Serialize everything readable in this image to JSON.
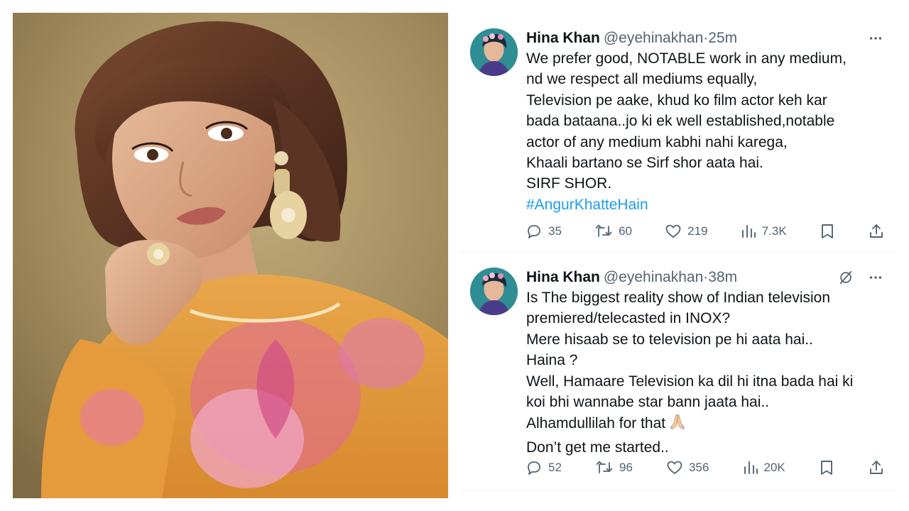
{
  "photo": {
    "subject": "portrait-photo"
  },
  "tweets": [
    {
      "name": "Hina Khan",
      "handle": "@eyehinakhan",
      "dot": "·",
      "time": "25m",
      "lines": [
        "We prefer good, NOTABLE work in any medium,",
        "nd we respect all mediums equally,",
        "Television pe aake, khud ko film actor keh kar",
        "bada bataana..jo ki ek well established,notable",
        "actor of any medium kabhi nahi karega,",
        "Khaali bartano se Sirf shor aata hai.",
        "SIRF SHOR."
      ],
      "hashtag": "#AngurKhatteHain",
      "replies": "35",
      "retweets": "60",
      "likes": "219",
      "views": "7.3K"
    },
    {
      "name": "Hina Khan",
      "handle": "@eyehinakhan",
      "dot": "·",
      "time": "38m",
      "lines": [
        "Is The biggest reality show of Indian television",
        "premiered/telecasted in INOX?",
        "Mere hisaab se to television pe hi aata hai..",
        "Haina ?",
        "Well, Hamaare Television ka dil hi itna bada hai ki",
        "koi bhi wannabe star bann jaata hai..",
        "Alhamdullilah for that",
        "Don’t get me started.."
      ],
      "replies": "52",
      "retweets": "96",
      "likes": "356",
      "views": "20K"
    }
  ],
  "colors": {
    "text": "#0f1419",
    "secondary": "#536471",
    "link": "#1d9bf0",
    "divider": "#eff3f4"
  },
  "icons": {
    "more": "more-icon",
    "grok": "grok-icon",
    "reply": "reply-icon",
    "retweet": "retweet-icon",
    "like": "heart-icon",
    "views": "views-icon",
    "bookmark": "bookmark-icon",
    "share": "share-icon",
    "emoji": "folded-hands-emoji"
  }
}
